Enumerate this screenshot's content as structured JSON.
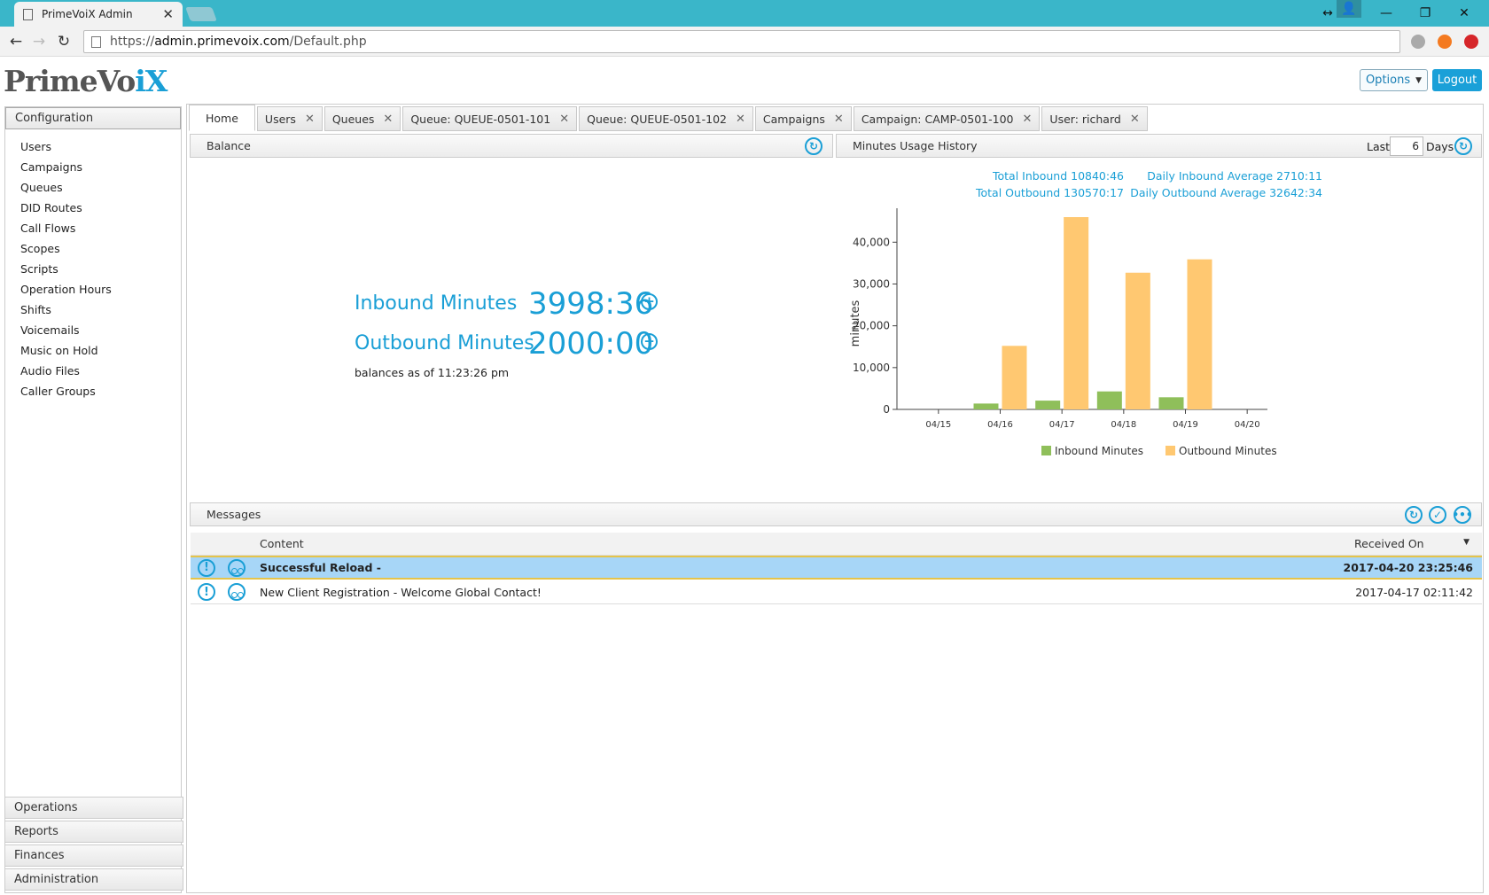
{
  "browser": {
    "tab_title": "PrimeVoiX Admin",
    "url_scheme": "https://",
    "url_host": "admin.primevoix.com",
    "url_path": "/Default.php"
  },
  "header": {
    "logo_main": "PrimeVo",
    "logo_accent": "iX",
    "options_label": "Options",
    "logout_label": "Logout"
  },
  "sidebar": {
    "sections": [
      "Configuration",
      "Operations",
      "Reports",
      "Finances",
      "Administration"
    ],
    "items": [
      "Users",
      "Campaigns",
      "Queues",
      "DID Routes",
      "Call Flows",
      "Scopes",
      "Scripts",
      "Operation Hours",
      "Shifts",
      "Voicemails",
      "Music on Hold",
      "Audio Files",
      "Caller Groups"
    ]
  },
  "tabs": [
    {
      "label": "Home"
    },
    {
      "label": "Users"
    },
    {
      "label": "Queues"
    },
    {
      "label": "Queue: QUEUE-0501-101"
    },
    {
      "label": "Queue: QUEUE-0501-102"
    },
    {
      "label": "Campaigns"
    },
    {
      "label": "Campaign: CAMP-0501-100"
    },
    {
      "label": "User: richard"
    }
  ],
  "balance": {
    "panel_title": "Balance",
    "inbound_label": "Inbound Minutes",
    "inbound_value": "3998:36",
    "outbound_label": "Outbound Minutes",
    "outbound_value": "2000:00",
    "as_of": "balances as of 11:23:26 pm"
  },
  "usage": {
    "panel_title": "Minutes Usage History",
    "last_label": "Last",
    "days_value": "6",
    "days_label": "Days",
    "total_inbound": "Total Inbound 10840:46",
    "total_outbound": "Total Outbound 130570:17",
    "daily_inbound": "Daily Inbound Average 2710:11",
    "daily_outbound": "Daily Outbound Average 32642:34"
  },
  "chart_data": {
    "type": "bar",
    "categories": [
      "04/15",
      "04/16",
      "04/17",
      "04/18",
      "04/19",
      "04/20"
    ],
    "series": [
      {
        "name": "Inbound Minutes",
        "values": [
          0,
          1400,
          2100,
          4300,
          2900,
          0
        ],
        "color": "#8fbf5a"
      },
      {
        "name": "Outbound Minutes",
        "values": [
          0,
          15200,
          46800,
          32700,
          35900,
          0
        ],
        "color": "#ffc871"
      }
    ],
    "ylabel": "minutes",
    "ylim": [
      0,
      46000
    ],
    "yticks": [
      "0",
      "10,000",
      "20,000",
      "30,000",
      "40,000"
    ],
    "legend": "bottom"
  },
  "messages": {
    "panel_title": "Messages",
    "col_content": "Content",
    "col_received": "Received On",
    "rows": [
      {
        "content": "Successful Reload -",
        "received": "2017-04-20 23:25:46"
      },
      {
        "content": "New Client Registration - Welcome Global Contact!",
        "received": "2017-04-17 02:11:42"
      }
    ]
  }
}
